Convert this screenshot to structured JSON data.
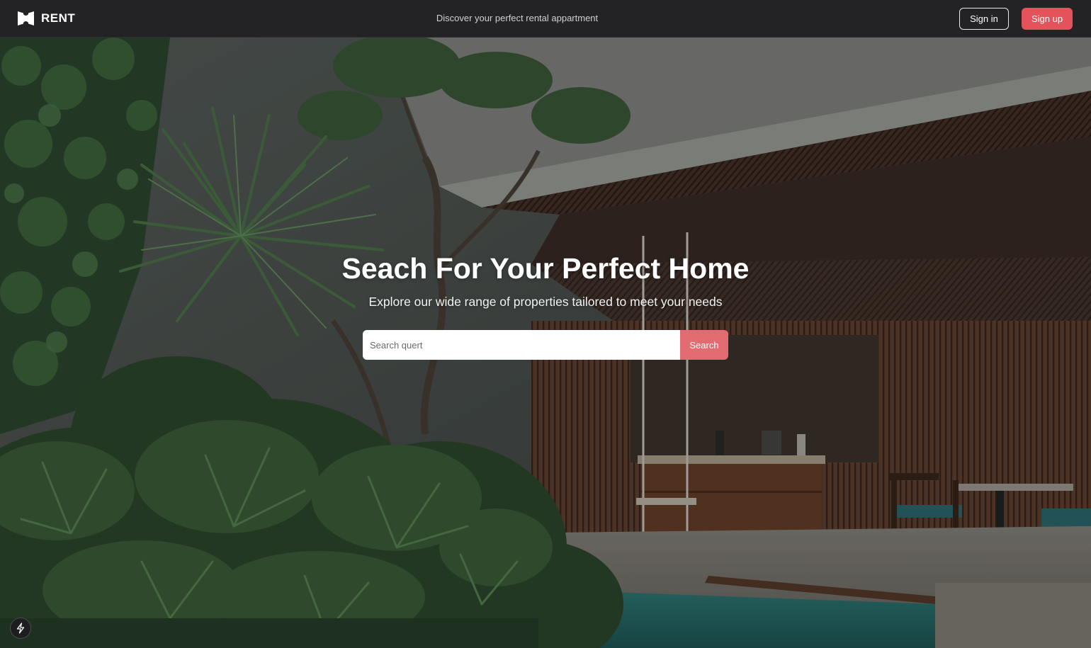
{
  "navbar": {
    "brand_name": "RENT",
    "brand_icon": "rent-logo-icon",
    "tagline": "Discover your perfect rental appartment",
    "signin_label": "Sign in",
    "signup_label": "Sign up"
  },
  "hero": {
    "title": "Seach For Your Perfect Home",
    "subtitle": "Explore our wide range of properties tailored to meet your needs",
    "search": {
      "placeholder": "Search quert",
      "button_label": "Search"
    },
    "background_description_icon": "hero-background-image"
  },
  "badge": {
    "icon": "lightning-bolt-icon"
  },
  "colors": {
    "navbar_bg": "#232325",
    "accent": "#e4525c",
    "search_button": "#e36b72",
    "text_primary": "#ffffff"
  }
}
